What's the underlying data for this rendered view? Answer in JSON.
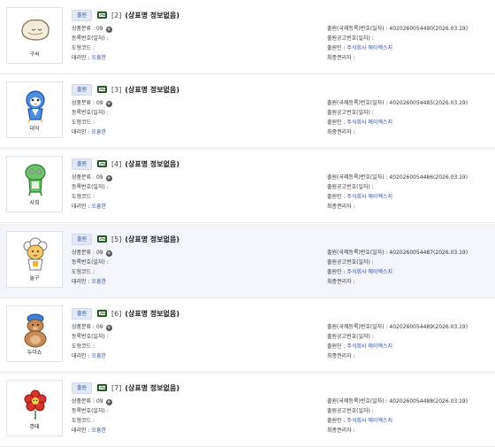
{
  "labels": {
    "class": "상품분류 :",
    "reg_no": "등록번호(일자) :",
    "design_code": "도형코드 :",
    "agent": "대리인 :",
    "app_no": "출원(국제등록)번호(일자) :",
    "pub_no": "출원공고번호(일자) :",
    "applicant": "출원인 :",
    "final_holder": "최종권리자 :"
  },
  "items": [
    {
      "badge": "출원",
      "num": "[2]",
      "name": "(상표명 정보없음)",
      "class": "09",
      "agent": "오흥한",
      "app_no": "4020260054490(2026.03.19)",
      "applicant": "주식회사 에이엑스지",
      "caption": "구씨",
      "icon": "blob-character-icon"
    },
    {
      "badge": "출원",
      "num": "[3]",
      "name": "(상표명 정보없음)",
      "class": "09",
      "agent": "오흥한",
      "app_no": "4020260054485(2026.03.19)",
      "applicant": "주식회사 에이엑스지",
      "caption": "대식",
      "icon": "blue-bird-character-icon"
    },
    {
      "badge": "출원",
      "num": "[4]",
      "name": "(상표명 정보없음)",
      "class": "09",
      "agent": "오흥한",
      "app_no": "4020260054486(2026.03.19)",
      "applicant": "주식회사 에이엑스지",
      "caption": "사희",
      "icon": "green-frog-character-icon"
    },
    {
      "badge": "출원",
      "num": "[5]",
      "name": "(상표명 정보없음)",
      "class": "09",
      "agent": "오흥한",
      "app_no": "4020260054487(2026.03.19)",
      "applicant": "주식회사 에이엑스지",
      "caption": "놀구",
      "icon": "sheep-character-icon"
    },
    {
      "badge": "출원",
      "num": "[6]",
      "name": "(상표명 정보없음)",
      "class": "09",
      "agent": "오흥한",
      "app_no": "4020260054489(2026.03.19)",
      "applicant": "주식회사 에이엑스지",
      "caption": "두더쇼",
      "icon": "bear-character-icon"
    },
    {
      "badge": "출원",
      "num": "[7]",
      "name": "(상표명 정보없음)",
      "class": "09",
      "agent": "오흥한",
      "app_no": "4020260054488(2026.03.19)",
      "applicant": "주식회사 에이엑스지",
      "caption": "깡태",
      "icon": "red-flower-character-icon"
    }
  ]
}
